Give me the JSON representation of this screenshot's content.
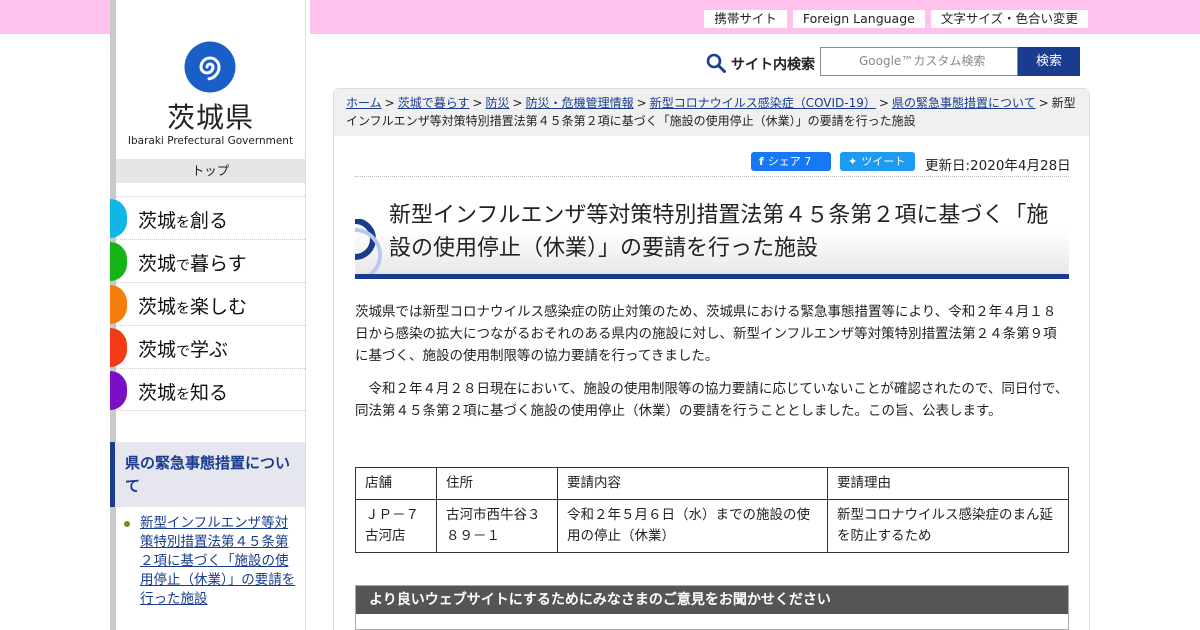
{
  "header": {
    "links": [
      "携帯サイト",
      "Foreign Language",
      "文字サイズ・色合い変更"
    ]
  },
  "logo": {
    "title": "茨城県",
    "subtitle": "Ibaraki Prefectural Government"
  },
  "top_button": "トップ",
  "nav": [
    {
      "pre": "茨城",
      "small": "を",
      "post": "創る",
      "color": "#11b5e8"
    },
    {
      "pre": "茨城",
      "small": "で",
      "post": "暮らす",
      "color": "#16b316"
    },
    {
      "pre": "茨城",
      "small": "を",
      "post": "楽しむ",
      "color": "#f57f0e"
    },
    {
      "pre": "茨城",
      "small": "で",
      "post": "学ぶ",
      "color": "#f23a17"
    },
    {
      "pre": "茨城",
      "small": "を",
      "post": "知る",
      "color": "#7a0fc7"
    }
  ],
  "side": {
    "section_title": "県の緊急事態措置について",
    "link": "新型インフルエンザ等対策特別措置法第４５条第２項に基づく「施設の使用停止（休業）」の要請を行った施設"
  },
  "search": {
    "label": "サイト内検索",
    "placeholder": "Google™カスタム検索",
    "button": "検索"
  },
  "breadcrumb": {
    "items": [
      "ホーム",
      "茨城で暮らす",
      "防災",
      "防災・危機管理情報",
      "新型コロナウイルス感染症（COVID-19）",
      "県の緊急事態措置について"
    ],
    "current": "新型インフルエンザ等対策特別措置法第４５条第２項に基づく「施設の使用停止（休業）」の要請を行った施設"
  },
  "share": {
    "facebook": "シェア 7",
    "twitter": "ツイート"
  },
  "updated": "更新日:2020年4月28日",
  "page_title": "新型インフルエンザ等対策特別措置法第４５条第２項に基づく「施設の使用停止（休業）」の要請を行った施設",
  "body": {
    "p1": "茨城県では新型コロナウイルス感染症の防止対策のため、茨城県における緊急事態措置等により、令和２年４月１８日から感染の拡大につながるおそれのある県内の施設に対し、新型インフルエンザ等対策特別措置法第２４条第９項に基づく、施設の使用制限等の協力要請を行ってきました。",
    "p2": "　令和２年４月２８日現在において、施設の使用制限等の協力要請に応じていないことが確認されたので、同日付で、同法第４５条第２項に基づく施設の使用停止（休業）の要請を行うこととしました。この旨、公表します。"
  },
  "table": {
    "headers": [
      "店舗",
      "住所",
      "要請内容",
      "要請理由"
    ],
    "rows": [
      [
        "ＪＰ－７古河店",
        "古河市西牛谷３８９－１",
        "令和２年５月６日（水）までの施設の使用の停止（休業）",
        "新型コロナウイルス感染症のまん延を防止するため"
      ]
    ]
  },
  "feedback": {
    "title": "より良いウェブサイトにするためにみなさまのご意見をお聞かせください"
  },
  "colors": {
    "brand": "#1a3c8f",
    "top_band": "#ffc2ec",
    "logo_blue": "#1a5fc7"
  }
}
